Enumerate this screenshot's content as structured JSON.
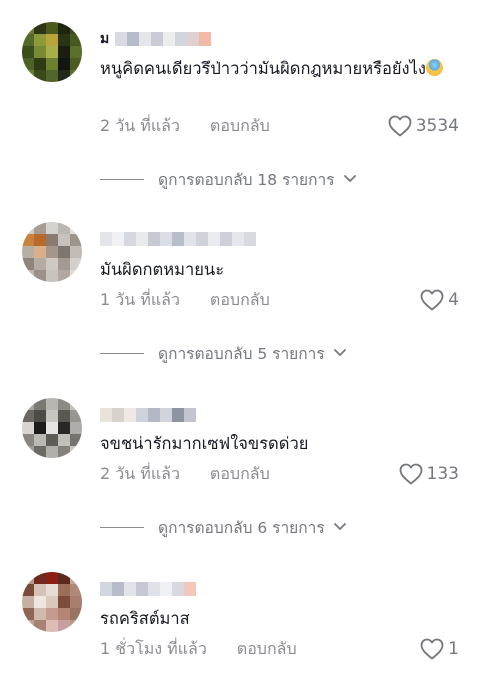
{
  "comments": [
    {
      "username_initial": "ม",
      "text": "หนูคิดคนเดียวรึป่าวว่ามันผิดกฎหมายหรือยังไง",
      "emoji": "scream-emoji",
      "time": "2 วัน ที่แล้ว",
      "reply_label": "ตอบกลับ",
      "likes": "3534",
      "view_replies": "ดูการตอบกลับ 18 รายการ"
    },
    {
      "username_initial": "",
      "text": "มันผิดกตหมายนะ",
      "time": "1 วัน ที่แล้ว",
      "reply_label": "ตอบกลับ",
      "likes": "4",
      "view_replies": "ดูการตอบกลับ 5 รายการ"
    },
    {
      "username_initial": "",
      "text": "จขชน่ารักมากเซฟใจขรดด่วย",
      "time": "2 วัน ที่แล้ว",
      "reply_label": "ตอบกลับ",
      "likes": "133",
      "view_replies": "ดูการตอบกลับ 6 รายการ"
    },
    {
      "username_initial": "",
      "text": "รถคริสต์มาส",
      "time": "1 ชั่วโมง ที่แล้ว",
      "reply_label": "ตอบกลับ",
      "likes": "1"
    }
  ],
  "colors": {
    "text_primary": "#161823",
    "text_secondary": "#8a8b91",
    "like_icon": "#757780"
  }
}
